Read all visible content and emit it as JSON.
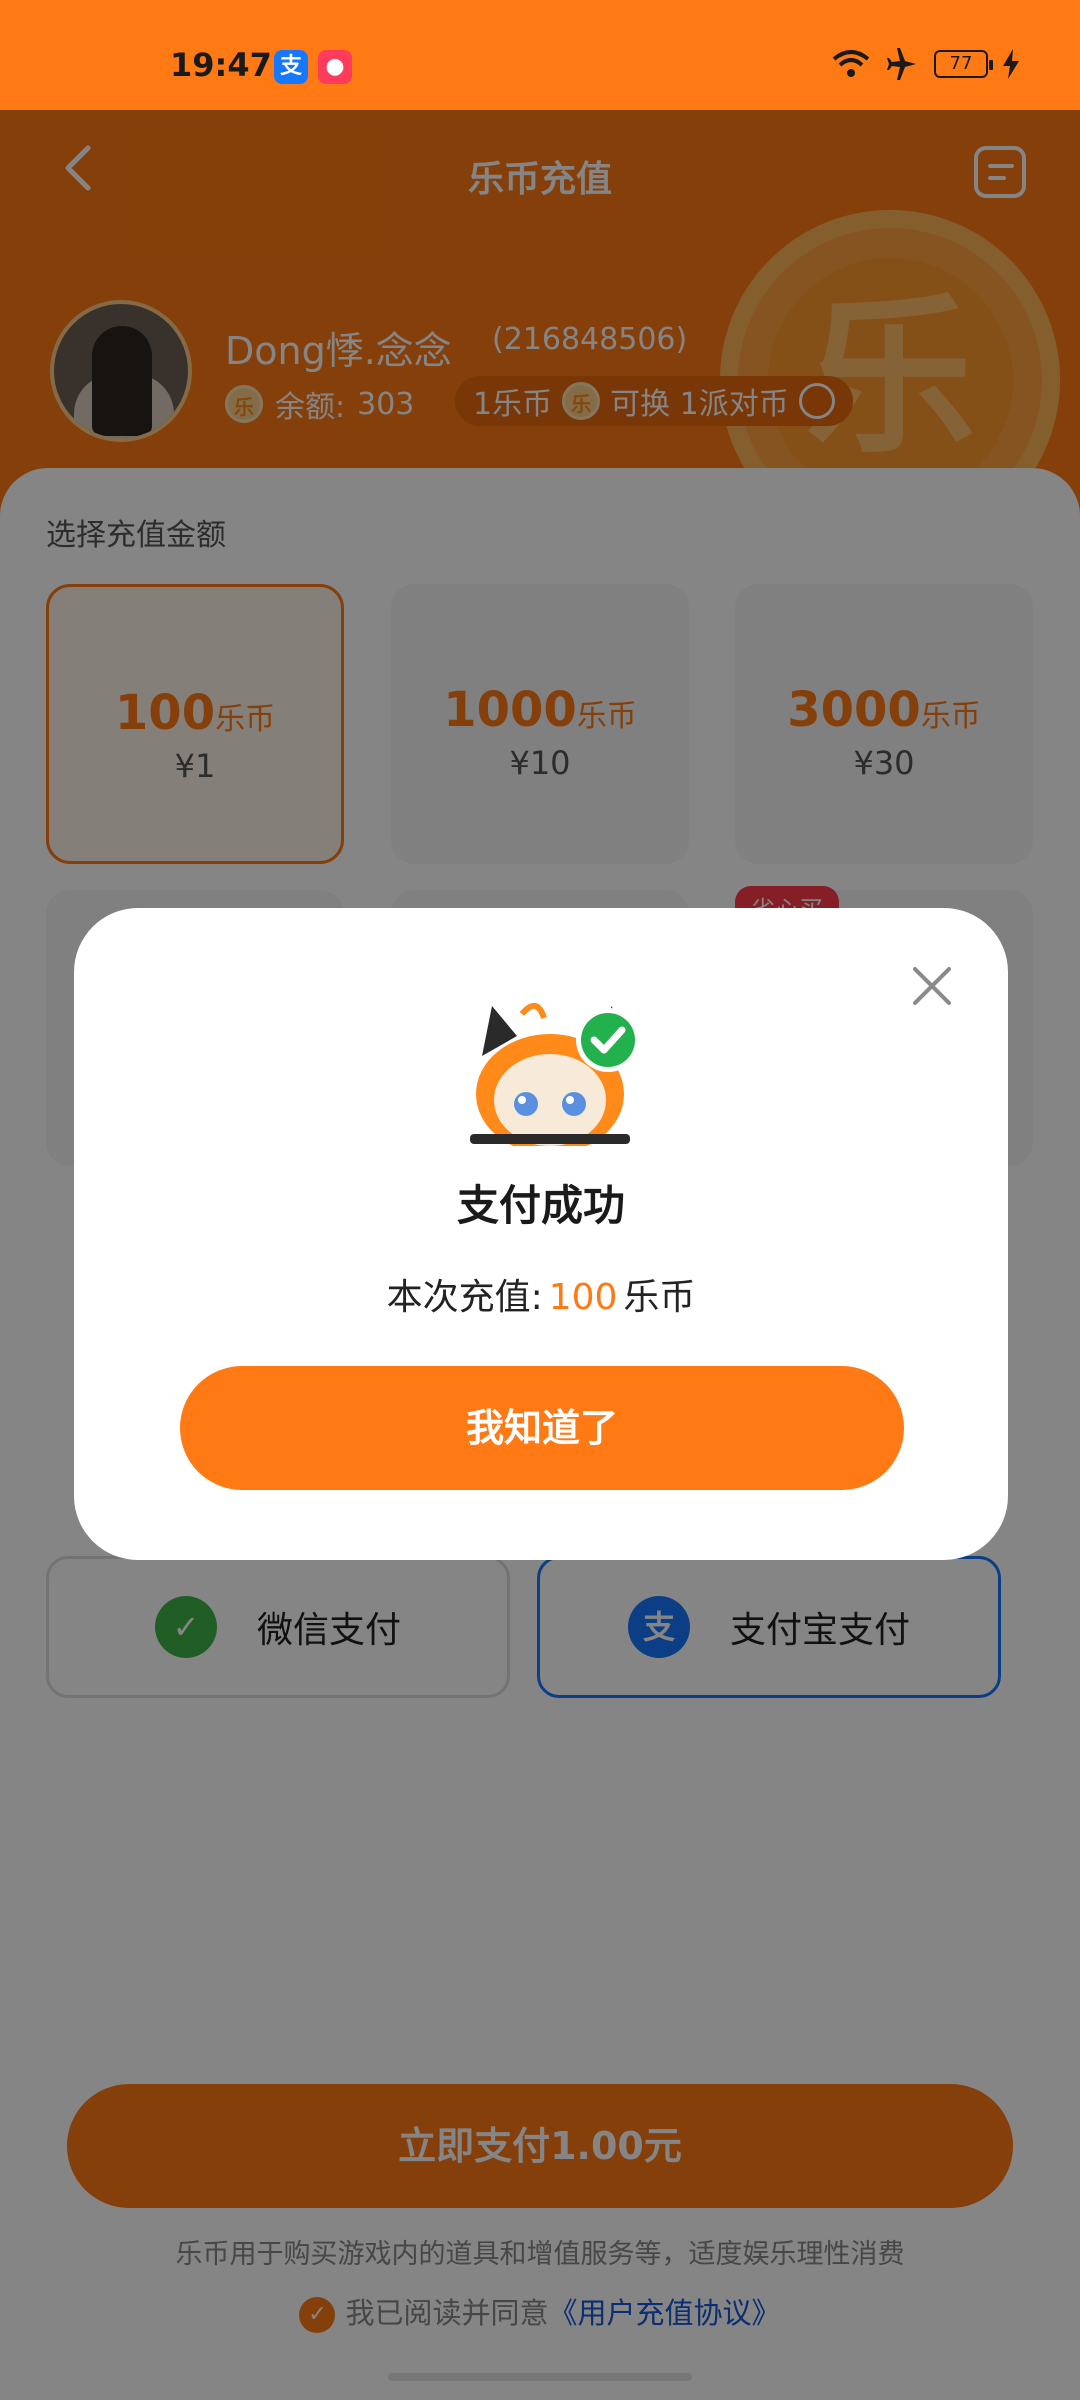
{
  "status_bar": {
    "time": "19:47",
    "battery": "77"
  },
  "header": {
    "title": "乐币充值",
    "user_name": "Dong悸.念念",
    "user_id": "(216848506)",
    "balance_label": "余额:",
    "balance_value": "303",
    "rate_left": "1乐币",
    "rate_right": "可换 1派对币",
    "coin_glyph": "乐"
  },
  "recharge": {
    "section_title": "选择充值金额",
    "packages": [
      {
        "coins": "100",
        "unit": "乐币",
        "price": "¥1",
        "selected": true
      },
      {
        "coins": "1000",
        "unit": "乐币",
        "price": "¥10",
        "selected": false
      },
      {
        "coins": "3000",
        "unit": "乐币",
        "price": "¥30",
        "selected": false
      }
    ],
    "tag": "省心买"
  },
  "payment": {
    "wechat_label": "微信支付",
    "alipay_label": "支付宝支付",
    "pay_button": "立即支付1.00元",
    "disclaimer": "乐币用于购买游戏内的道具和增值服务等，适度娱乐理性消费",
    "agree_prefix": "我已阅读并同意",
    "agree_link": "《用户充值协议》"
  },
  "dialog": {
    "title": "支付成功",
    "amount_prefix": "本次充值:",
    "amount_value": "100",
    "amount_unit": "乐币",
    "confirm_label": "我知道了"
  },
  "colors": {
    "accent": "#ff7a14",
    "alipay": "#1677ff",
    "wechat": "#3fb44a"
  }
}
